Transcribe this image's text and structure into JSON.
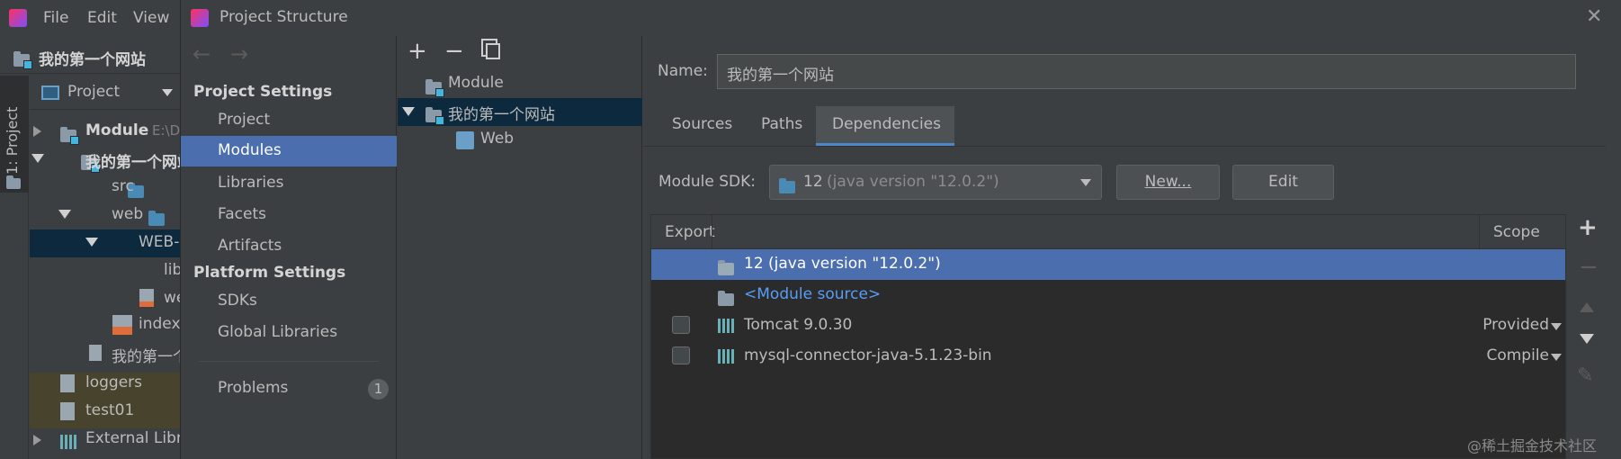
{
  "ide": {
    "menu": [
      "File",
      "Edit",
      "View"
    ],
    "breadcrumb": "我的第一个网站",
    "side_tab": "1: Project",
    "project_view_label": "Project",
    "tree": [
      {
        "label": "Module",
        "suffix": "E:\\D"
      },
      {
        "label": "我的第一个网站"
      },
      {
        "label": "src"
      },
      {
        "label": "web"
      },
      {
        "label": "WEB-I"
      },
      {
        "label": "lib"
      },
      {
        "label": "we"
      },
      {
        "label": "index"
      },
      {
        "label": "我的第一个"
      },
      {
        "label": "loggers"
      },
      {
        "label": "test01"
      },
      {
        "label": "External Libra"
      }
    ]
  },
  "dialog": {
    "title": "Project Structure",
    "project_settings_header": "Project Settings",
    "project_settings_items": [
      "Project",
      "Modules",
      "Libraries",
      "Facets",
      "Artifacts"
    ],
    "platform_settings_header": "Platform Settings",
    "platform_settings_items": [
      "SDKs",
      "Global Libraries"
    ],
    "problems_label": "Problems",
    "problems_count": "1",
    "module_tree": [
      {
        "label": "Module"
      },
      {
        "label": "我的第一个网站"
      },
      {
        "label": "Web"
      }
    ],
    "name_label": "Name:",
    "name_value": "我的第一个网站",
    "tabs": [
      "Sources",
      "Paths",
      "Dependencies"
    ],
    "active_tab": "Dependencies",
    "module_sdk_label": "Module SDK:",
    "sdk_value": "12",
    "sdk_version": "(java version \"12.0.2\")",
    "new_button": "New...",
    "edit_button": "Edit",
    "table": {
      "col_export": "Export",
      "col_scope": "Scope",
      "rows": [
        {
          "name": "12 (java version \"12.0.2\")",
          "scope": "",
          "selected": true,
          "checkbox": false
        },
        {
          "name": "<Module source>",
          "scope": "",
          "selected": false,
          "checkbox": false,
          "link": true
        },
        {
          "name": "Tomcat 9.0.30",
          "scope": "Provided",
          "selected": false,
          "checkbox": true
        },
        {
          "name": "mysql-connector-java-5.1.23-bin",
          "scope": "Compile",
          "selected": false,
          "checkbox": true
        }
      ]
    },
    "watermark": "@稀土掘金技术社区"
  },
  "colors": {
    "selection": "#4b6eaf",
    "tree_selection": "#0d293e",
    "link": "#589df6"
  }
}
